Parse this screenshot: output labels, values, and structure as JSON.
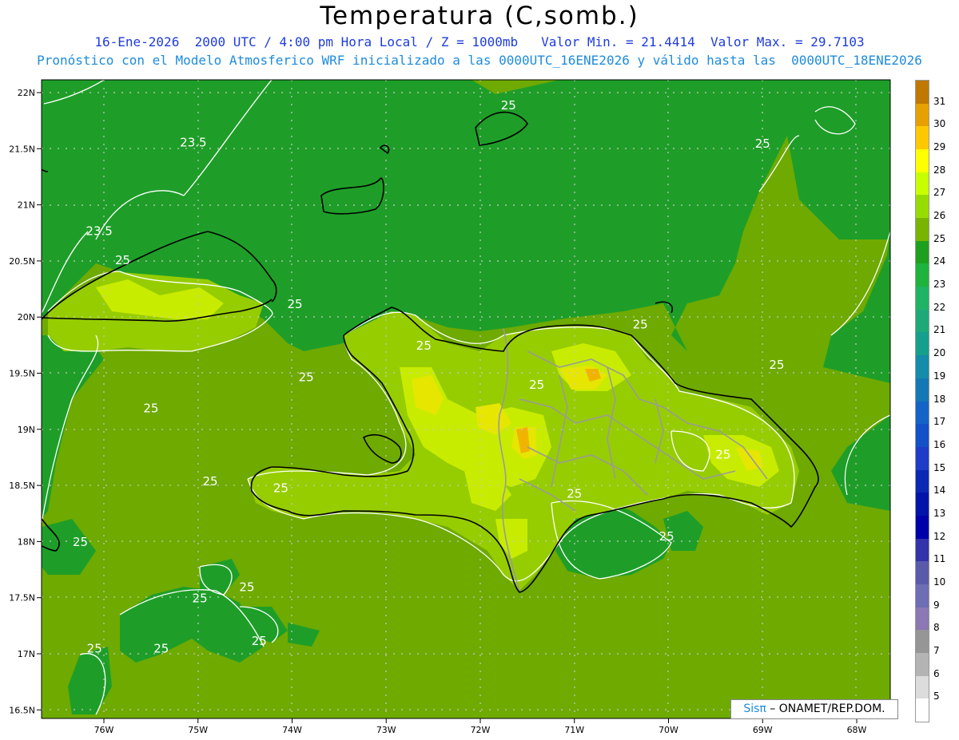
{
  "header": {
    "title": "Temperatura (C,somb.)",
    "subtitle_1": "16-Ene-2026  2000 UTC / 4:00 pm Hora Local / Z = 1000mb   Valor Min. = 21.4414  Valor Max. = 29.7103",
    "subtitle_2": "Pronóstico con el Modelo Atmosferico WRF inicializado a las 0000UTC_16ENE2026 y válido hasta las  0000UTC_18ENE2026"
  },
  "axes": {
    "lat_labels": [
      "22N",
      "21.5N",
      "21N",
      "20.5N",
      "20N",
      "19.5N",
      "19N",
      "18.5N",
      "18N",
      "17.5N",
      "17N",
      "16.5N"
    ],
    "lon_labels": [
      "76W",
      "75W",
      "74W",
      "73W",
      "72W",
      "71W",
      "70W",
      "69W",
      "68W"
    ]
  },
  "contour_labels": [
    {
      "value": "23.5",
      "lon": -75.05,
      "lat": 21.52
    },
    {
      "value": "23.5",
      "lon": -76.05,
      "lat": 20.73
    },
    {
      "value": "25",
      "lon": -75.8,
      "lat": 20.47
    },
    {
      "value": "25",
      "lon": -73.97,
      "lat": 20.08
    },
    {
      "value": "25",
      "lon": -72.6,
      "lat": 19.71
    },
    {
      "value": "25",
      "lon": -73.85,
      "lat": 19.43
    },
    {
      "value": "25",
      "lon": -75.5,
      "lat": 19.15
    },
    {
      "value": "25",
      "lon": -74.87,
      "lat": 18.5
    },
    {
      "value": "25",
      "lon": -74.12,
      "lat": 18.44
    },
    {
      "value": "25",
      "lon": -76.25,
      "lat": 17.96
    },
    {
      "value": "25",
      "lon": -74.98,
      "lat": 17.46
    },
    {
      "value": "25",
      "lon": -74.48,
      "lat": 17.56
    },
    {
      "value": "25",
      "lon": -75.39,
      "lat": 17.01
    },
    {
      "value": "25",
      "lon": -76.1,
      "lat": 17.01
    },
    {
      "value": "25",
      "lon": -74.35,
      "lat": 17.08
    },
    {
      "value": "25",
      "lon": -71.4,
      "lat": 19.36
    },
    {
      "value": "25",
      "lon": -71.0,
      "lat": 18.39
    },
    {
      "value": "25",
      "lon": -70.02,
      "lat": 18.01
    },
    {
      "value": "25",
      "lon": -69.42,
      "lat": 18.74
    },
    {
      "value": "25",
      "lon": -70.3,
      "lat": 19.9
    },
    {
      "value": "25",
      "lon": -68.85,
      "lat": 19.54
    },
    {
      "value": "25",
      "lon": -71.7,
      "lat": 21.85
    },
    {
      "value": "25",
      "lon": -69.0,
      "lat": 21.51
    }
  ],
  "legend": {
    "labels": [
      "31",
      "30",
      "29",
      "28",
      "27",
      "26",
      "25",
      "24",
      "23",
      "22",
      "21",
      "20",
      "19",
      "18",
      "17",
      "16",
      "15",
      "14",
      "13",
      "12",
      "11",
      "10",
      "9",
      "8",
      "7",
      "6",
      "5"
    ],
    "colors": [
      "#c07800",
      "#e6a000",
      "#ffc800",
      "#ffff00",
      "#c8ff00",
      "#96dc00",
      "#78b400",
      "#1ea01e",
      "#1eb43c",
      "#1eb464",
      "#1eaa78",
      "#14a08c",
      "#148caa",
      "#1478b4",
      "#1464c8",
      "#1450c8",
      "#1e3cc8",
      "#0a28b4",
      "#0014aa",
      "#0000aa",
      "#3232aa",
      "#5a5aaa",
      "#6e6eb4",
      "#8c78b4",
      "#969696",
      "#b4b4b4",
      "#dcdcdc",
      "#ffffff"
    ]
  },
  "credit": {
    "sis": "Sisπ",
    "org": " – ONAMET/REP.DOM."
  },
  "colors": {
    "ocean_base": "#6eaa00",
    "cool_sea": "#1e9e28",
    "warm_land": "#96cd00",
    "hot_land": "#c8ec00",
    "hottest": "#e6e600",
    "peak": "#f0b400",
    "contour": "#ffffff",
    "coast": "#000000",
    "border": "#9a9a9a",
    "grid": "#c8c8c8"
  }
}
